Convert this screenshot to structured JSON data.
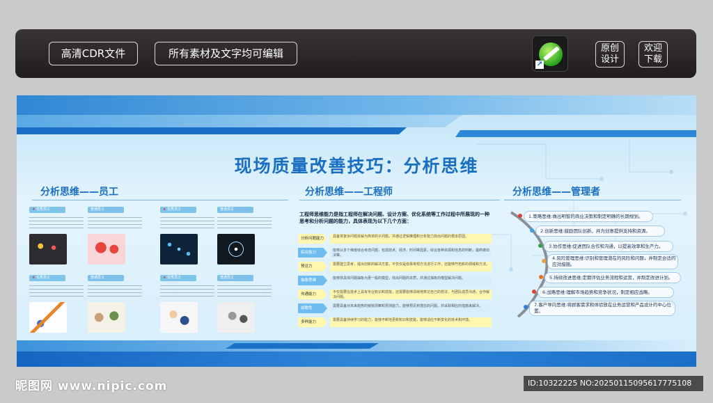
{
  "toolbar": {
    "hd_label": "高清CDR文件",
    "edit_label": "所有素材及文字均可编辑",
    "original_line1": "原创",
    "original_line2": "设计",
    "download_line1": "欢迎",
    "download_line2": "下载",
    "app_icon": "coreldraw-icon"
  },
  "poster": {
    "title": "现场质量改善技巧：分析思维",
    "sections": {
      "employee": "分析思维——员工",
      "engineer": "分析思维——工程师",
      "manager": "分析思维——管理者"
    },
    "employee_tags": [
      "优秀员工",
      "普通员工",
      "优秀员工",
      "普通员工",
      "优秀员工",
      "普通员工",
      "优秀员工",
      "普通员工"
    ],
    "engineer": {
      "intro": "工程师思维能力是指工程师在解决问题、设计方案、优化系统等工作过程中所展现的一种思考和分析问题的能力，具体表现为以下几个方面：",
      "rows": [
        {
          "label": "分析问题能力",
          "text": "具备将复杂问题拆解为简单的子问题，并通过逻辑推理和分析能力找出问题的根本原因。"
        },
        {
          "label": "综合能力",
          "text": "能够从多个维度综合考虑问题，包括技术、经济、时间等因素，综合各种资源和信息的判断，最终做出决策。"
        },
        {
          "label": "预见力",
          "text": "需要建立思考，提出创新的解决方案，不仅仅是依靠常规方法进行工作，还能够开拓新的领域和方法。"
        },
        {
          "label": "抽象思维",
          "text": "能够将具体问题抽象为更一般的模型，找出问题的本质，并通过抽象的模型解决问题。"
        },
        {
          "label": "沟通能力",
          "text": "不仅需要在技术上具有专业知识和技能，还需要能够清晰地表达自己的想法，与团队成员沟通，合作解决问题。"
        },
        {
          "label": "前瞻性",
          "text": "需要具备对未来趋势的敏锐洞察和预测能力，能够预见到潜在的问题，并采取相应的措施来解决。"
        },
        {
          "label": "多样能力",
          "text": "需要具备持续学习的能力，能够不断地更新知识和技能，能够适应不断变化的技术和环境。"
        }
      ]
    },
    "manager_items": [
      "1.策略思维:做出明智的商业决策和制定明确的长期规划。",
      "2.创新思维:鼓励团队创新，并为创意提供支持和资源。",
      "3.协作思维:促进团队合作和沟通，以提高效率和生产力。",
      "4.风险管理思维:识别和管理潜在的风险和问题，并制定合适的应对措施。",
      "5.持续改进思维:定期评估业务流程和运营，并制定改进计划。",
      "6.战略思维:理解市场趋势和竞争状况，制定相应战略。",
      "7.客户导向思维:将顾客需求和体验放在业务运营和产品设计的中心位置。"
    ],
    "manager_dot_colors": [
      "#e23b3b",
      "#3aa0e8",
      "#3a9d4a",
      "#e8a33a",
      "#e2701f",
      "#e23b3b",
      "#2a7ed6"
    ]
  },
  "watermark": {
    "site": "昵图网 www.nipic.com",
    "id_text": "ID:10322225 NO:20250115095617775108"
  }
}
